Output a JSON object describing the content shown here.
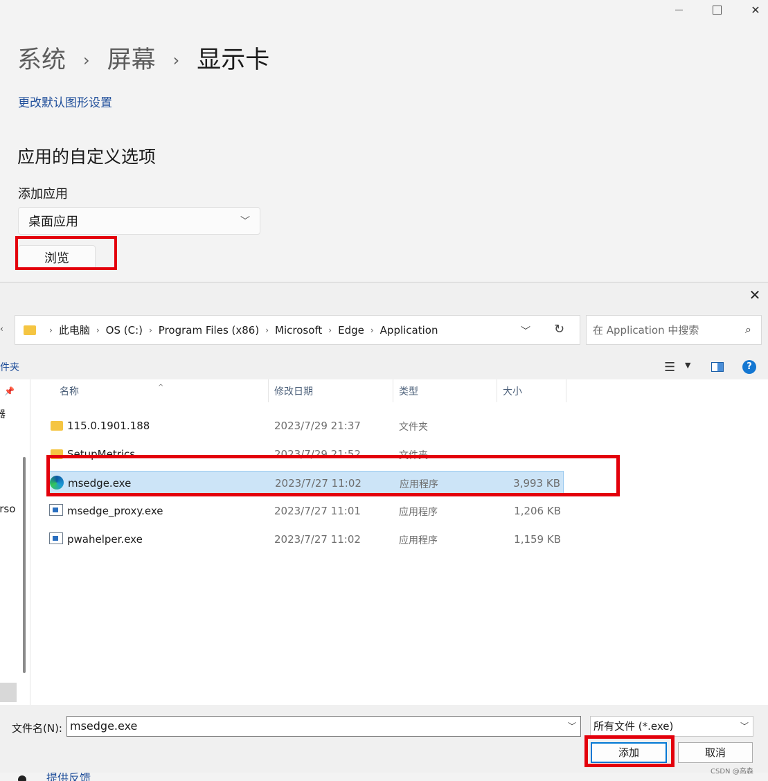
{
  "window": {
    "minimize_icon": "minimize-icon",
    "maximize_icon": "maximize-icon",
    "close_glyph": "✕"
  },
  "settings": {
    "breadcrumb": [
      "系统",
      "屏幕",
      "显示卡"
    ],
    "breadcrumb_sep": "›",
    "link_default_graphics": "更改默认图形设置",
    "section_title": "应用的自定义选项",
    "add_app_label": "添加应用",
    "app_type_select": "桌面应用",
    "browse_button": "浏览",
    "feedback_link": "提供反馈"
  },
  "dialog": {
    "close_glyph": "✕",
    "address": {
      "segments": [
        "此电脑",
        "OS (C:)",
        "Program Files (x86)",
        "Microsoft",
        "Edge",
        "Application"
      ],
      "sep": "›"
    },
    "search_placeholder": "在 Application 中搜索",
    "toolbar_left": "件夹",
    "nav_pane": {
      "item_1": "器",
      "item_2": "erso"
    },
    "columns": {
      "name": "名称",
      "date": "修改日期",
      "type": "类型",
      "size": "大小"
    },
    "files": [
      {
        "name": "115.0.1901.188",
        "date": "2023/7/29 21:37",
        "type": "文件夹",
        "size": "",
        "icon": "folder-icon"
      },
      {
        "name": "SetupMetrics",
        "date": "2023/7/29 21:52",
        "type": "文件夹",
        "size": "",
        "icon": "folder-icon"
      },
      {
        "name": "msedge.exe",
        "date": "2023/7/27 11:02",
        "type": "应用程序",
        "size": "3,993 KB",
        "icon": "edge-icon",
        "selected": true
      },
      {
        "name": "msedge_proxy.exe",
        "date": "2023/7/27 11:01",
        "type": "应用程序",
        "size": "1,206 KB",
        "icon": "exe-icon"
      },
      {
        "name": "pwahelper.exe",
        "date": "2023/7/27 11:02",
        "type": "应用程序",
        "size": "1,159 KB",
        "icon": "exe-icon"
      }
    ],
    "filename_label": "文件名(N):",
    "filename_value": "msedge.exe",
    "filetype_value": "所有文件 (*.exe)",
    "add_button": "添加",
    "cancel_button": "取消"
  },
  "highlight_color": "#e3000b",
  "watermark": "CSDN @高森"
}
